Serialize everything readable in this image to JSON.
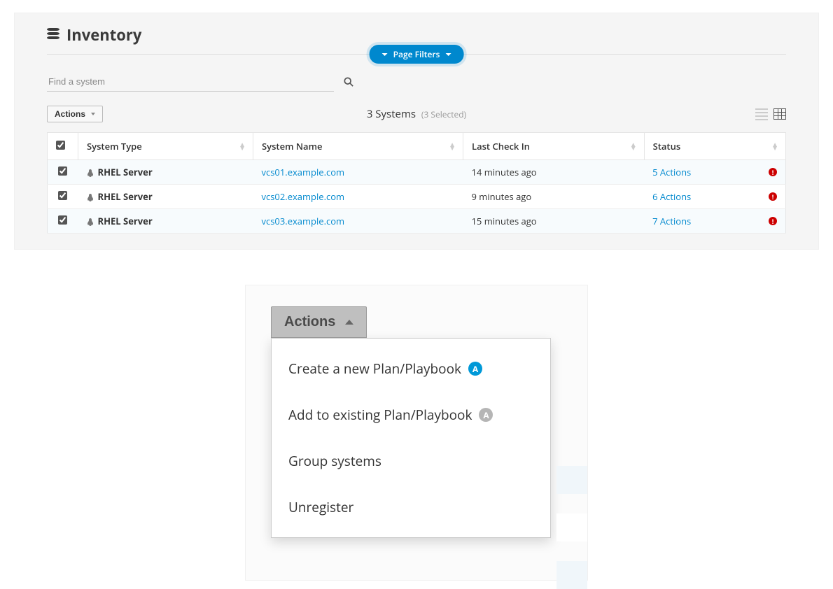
{
  "page": {
    "title": "Inventory",
    "filters_label": "Page Filters"
  },
  "search": {
    "placeholder": "Find a system"
  },
  "toolbar": {
    "actions_label": "Actions",
    "count_label": "3 Systems",
    "selected_label": "(3 Selected)"
  },
  "table": {
    "headers": {
      "type": "System Type",
      "name": "System Name",
      "checkin": "Last Check In",
      "status": "Status"
    },
    "rows": [
      {
        "type": "RHEL Server",
        "name": "vcs01.example.com",
        "checkin": "14 minutes ago",
        "status": "5 Actions"
      },
      {
        "type": "RHEL Server",
        "name": "vcs02.example.com",
        "checkin": "9 minutes ago",
        "status": "6 Actions"
      },
      {
        "type": "RHEL Server",
        "name": "vcs03.example.com",
        "checkin": "15 minutes ago",
        "status": "7 Actions"
      }
    ]
  },
  "menu": {
    "button_label": "Actions",
    "items": [
      {
        "label": "Create a new Plan/Playbook",
        "badge": "A",
        "badge_style": "blue"
      },
      {
        "label": "Add to existing Plan/Playbook",
        "badge": "A",
        "badge_style": "grey"
      },
      {
        "label": "Group systems"
      },
      {
        "label": "Unregister"
      }
    ]
  }
}
